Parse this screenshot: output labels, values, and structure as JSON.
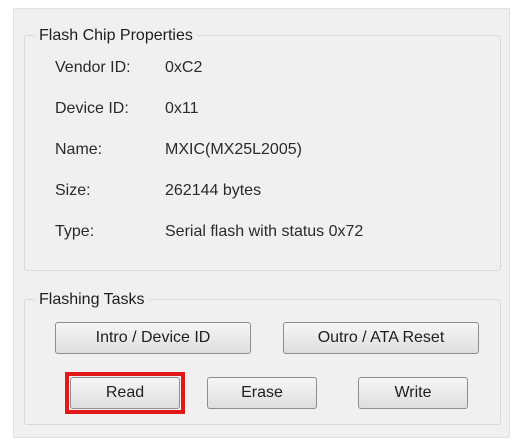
{
  "flash_chip_properties": {
    "title": "Flash Chip Properties",
    "rows": [
      {
        "label": "Vendor ID:",
        "value": "0xC2"
      },
      {
        "label": "Device ID:",
        "value": "0x11"
      },
      {
        "label": "Name:",
        "value": "MXIC(MX25L2005)"
      },
      {
        "label": "Size:",
        "value": "262144 bytes"
      },
      {
        "label": "Type:",
        "value": "Serial flash with status 0x72"
      }
    ]
  },
  "flashing_tasks": {
    "title": "Flashing Tasks",
    "buttons": {
      "intro": "Intro / Device ID",
      "outro": "Outro / ATA Reset",
      "read": "Read",
      "erase": "Erase",
      "write": "Write"
    }
  },
  "colors": {
    "panel_background": "#f0f0f0",
    "highlight_border": "#e01818"
  }
}
